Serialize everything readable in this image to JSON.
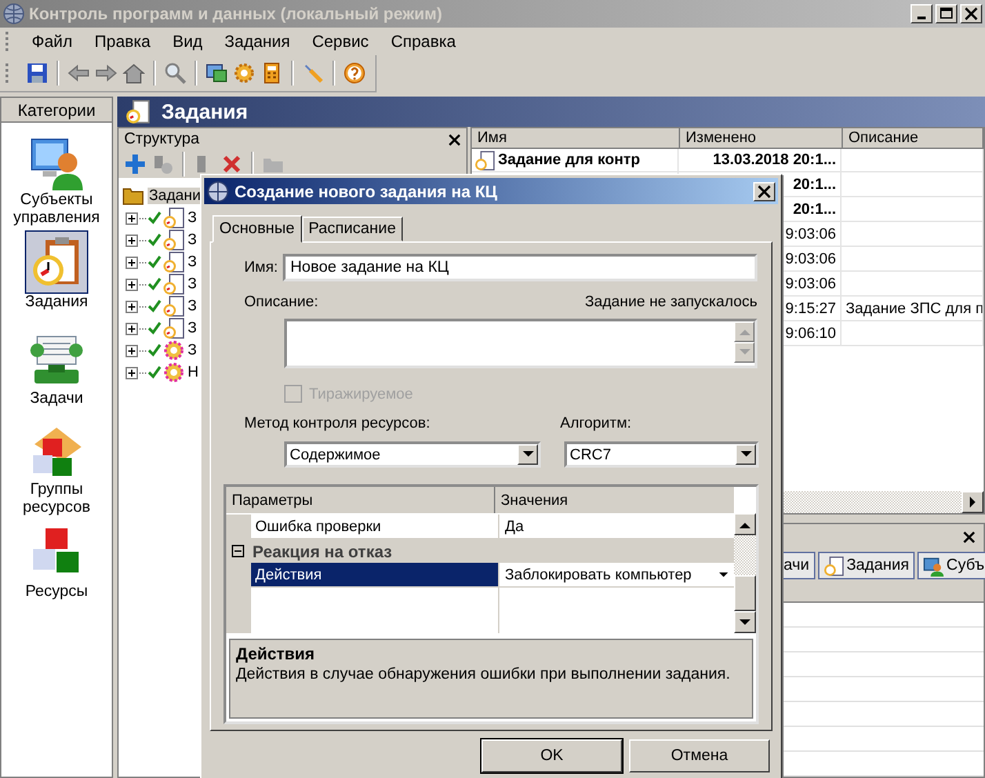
{
  "window": {
    "title": "Контроль программ и данных (локальный режим)"
  },
  "menu": [
    "Файл",
    "Правка",
    "Вид",
    "Задания",
    "Сервис",
    "Справка"
  ],
  "sidebar": {
    "header": "Категории",
    "items": [
      {
        "label": "Субъекты управления",
        "kind": "subjects",
        "selected": false
      },
      {
        "label": "Задания",
        "kind": "tasks",
        "selected": true
      },
      {
        "label": "Задачи",
        "kind": "jobs",
        "selected": false
      },
      {
        "label": "Группы ресурсов",
        "kind": "groups",
        "selected": false
      },
      {
        "label": "Ресурсы",
        "kind": "resources",
        "selected": false
      }
    ]
  },
  "section_title": "Задания",
  "structure": {
    "title": "Структура",
    "tree": {
      "label": "Задани",
      "selected": true,
      "children": [
        {
          "label": "З",
          "kind": "task",
          "expanded": false,
          "active": true
        },
        {
          "label": "З",
          "kind": "task",
          "expanded": false,
          "active": true
        },
        {
          "label": "З",
          "kind": "task",
          "expanded": false,
          "active": true
        },
        {
          "label": "З",
          "kind": "task",
          "expanded": false,
          "active": true
        },
        {
          "label": "З",
          "kind": "task",
          "expanded": false,
          "active": true
        },
        {
          "label": "З",
          "kind": "task",
          "expanded": false,
          "active": true
        },
        {
          "label": "З",
          "kind": "gear",
          "expanded": false,
          "active": true
        },
        {
          "label": "Н",
          "kind": "gear",
          "expanded": false,
          "active": true
        }
      ]
    }
  },
  "list": {
    "columns": [
      "Имя",
      "Изменено",
      "Описание"
    ],
    "rows": [
      {
        "name": "Задание для контр",
        "modified": "13.03.2018  20:1...",
        "bold": true
      },
      {
        "modified": "20:1...",
        "bold": true
      },
      {
        "modified": "20:1...",
        "bold": true
      },
      {
        "modified": "9:03:06",
        "bold": false
      },
      {
        "modified": "9:03:06",
        "bold": false
      },
      {
        "modified": "9:03:06",
        "bold": false
      },
      {
        "modified": "9:15:27",
        "description": "Задание ЗПС для п",
        "bold": false
      },
      {
        "modified": "9:06:10",
        "bold": false
      }
    ]
  },
  "bottom_panel": {
    "tabs": [
      {
        "label": "ачи",
        "kind": "plain"
      },
      {
        "label": "Задания",
        "kind": "task"
      },
      {
        "label": "Субъ",
        "kind": "subject"
      }
    ]
  },
  "dialog": {
    "title": "Создание нового задания на КЦ",
    "tabs": [
      {
        "label": "Основные",
        "selected": true
      },
      {
        "label": "Расписание",
        "selected": false
      }
    ],
    "name_label": "Имя:",
    "name_value": "Новое задание на КЦ",
    "description_label": "Описание:",
    "status": "Задание не запускалось",
    "replicable": {
      "label": "Тиражируемое",
      "checked": false,
      "disabled": true
    },
    "method_label": "Метод контроля ресурсов:",
    "method_value": "Содержимое",
    "algorithm_label": "Алгоритм:",
    "algorithm_value": "CRC7",
    "properties": {
      "columns": [
        "Параметры",
        "Значения"
      ],
      "rows": [
        {
          "kind": "property",
          "name": "Ошибка проверки",
          "value": "Да",
          "selected": false
        },
        {
          "kind": "category",
          "name": "Реакция на отказ",
          "expanded": true
        },
        {
          "kind": "property",
          "name": "Действия",
          "value": "Заблокировать компьютер",
          "selected": true
        }
      ],
      "help_title": "Действия",
      "help_text": "Действия в случае обнаружения ошибки при выполнении задания."
    },
    "buttons": [
      {
        "label": "OK",
        "default": true
      },
      {
        "label": "Отмена",
        "default": false
      }
    ]
  }
}
